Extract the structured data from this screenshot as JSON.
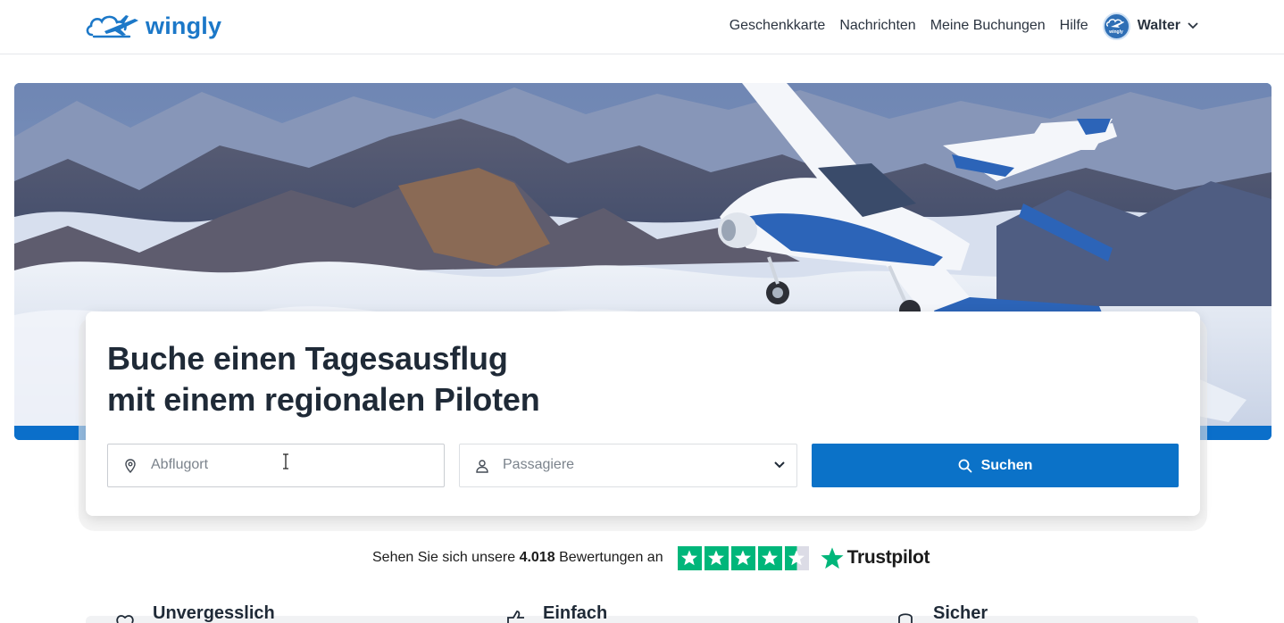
{
  "brand": {
    "name": "wingly"
  },
  "nav": {
    "links": [
      "Geschenkkarte",
      "Nachrichten",
      "Meine Buchungen",
      "Hilfe"
    ],
    "user_name": "Walter",
    "avatar_text": "wingly"
  },
  "search": {
    "headline_line1": "Buche einen Tagesausflug",
    "headline_line2": "mit einem regionalen Piloten",
    "departure_placeholder": "Abflugort",
    "passengers_placeholder": "Passagiere",
    "search_label": "Suchen"
  },
  "trustpilot": {
    "prefix": "Sehen Sie sich unsere",
    "count": "4.018",
    "suffix": "Bewertungen an",
    "brand": "Trustpilot",
    "rating_stars": 4.5
  },
  "features": [
    "Unvergesslich",
    "Einfach",
    "Sicher"
  ],
  "colors": {
    "primary": "#0b72c8",
    "logo": "#1c78c8",
    "trustpilot_green": "#00b67a",
    "text": "#1f2a37"
  }
}
